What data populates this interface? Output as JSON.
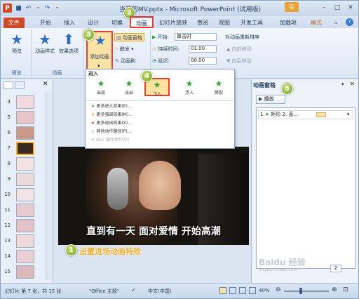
{
  "window": {
    "title": "当我的MV.pptx - Microsoft PowerPoint (试用版)",
    "context_badge": "绘",
    "format_tab": "格式"
  },
  "tabs": [
    "文件",
    "开始",
    "插入",
    "设计",
    "切换",
    "动画",
    "幻灯片放映",
    "审阅",
    "视图",
    "开发工具",
    "加载项"
  ],
  "ribbon": {
    "preview_label": "预览",
    "preview_group": "预览",
    "effect_label": "动画样式",
    "options_label": "效果选项",
    "animation_group": "动画",
    "add_anim_label": "添加动画",
    "pane_label": "动画窗格",
    "trigger_label": "触发",
    "painter_label": "动画刷",
    "start_label": "开始:",
    "start_value": "单击时",
    "duration_label": "持续时间:",
    "duration_value": "01.00",
    "delay_label": "延迟:",
    "delay_value": "00.00",
    "reorder_label": "对动画重新排序",
    "forward_label": "向前移动",
    "backward_label": "向后移动"
  },
  "gallery": {
    "header": "进入",
    "items": [
      "出现",
      "淡出",
      "飞入",
      "浮入",
      "劈裂"
    ],
    "more": [
      "更多进入效果(E)...",
      "更多强调效果(M)...",
      "更多退出效果(X)...",
      "其他动作路径(P)...",
      "OLE 操作动作(O)"
    ]
  },
  "slides": [
    "4",
    "5",
    "6",
    "7",
    "8",
    "9",
    "10",
    "11",
    "12",
    "13",
    "14",
    "15"
  ],
  "slide_caption": "直到有一天 面对爱情 开始高潮",
  "annotation_text": "设置进场动画特效",
  "callouts": [
    "1",
    "2",
    "3",
    "4",
    "5"
  ],
  "anim_pane": {
    "title": "动画窗格",
    "play_label": "播放",
    "item_label": "矩形 2: 直...",
    "item_num": "1",
    "page_num": "2"
  },
  "status": {
    "slide_info": "幻灯片 第 7 张，共 15 张",
    "theme": "\"Office 主题\"",
    "language": "中文(中国)",
    "zoom": "40%"
  },
  "watermark": "Baidu 经验",
  "watermark_sub": "jingyan.baidu.com",
  "colors": {
    "file_tab": "#d24726",
    "accent": "#f2b233",
    "callout": "#7cb22a",
    "highlight": "#e8402e"
  }
}
